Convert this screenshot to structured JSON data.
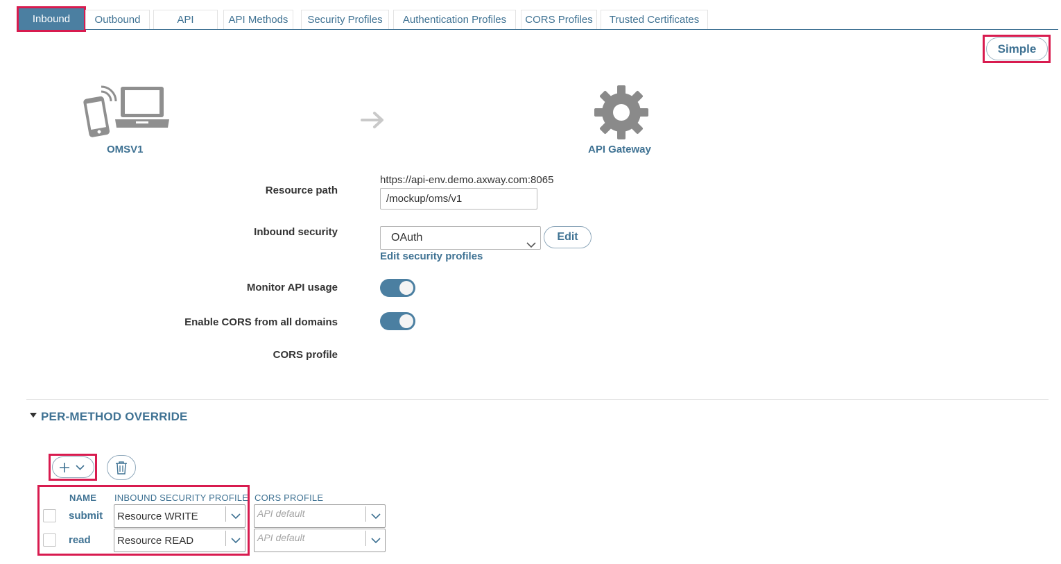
{
  "tabs": [
    {
      "label": "Inbound",
      "active": true
    },
    {
      "label": "Outbound"
    },
    {
      "label": "API"
    },
    {
      "label": "API Methods"
    },
    {
      "label": "Security Profiles"
    },
    {
      "label": "Authentication Profiles"
    },
    {
      "label": "CORS Profiles"
    },
    {
      "label": "Trusted Certificates"
    }
  ],
  "mode_button": "Simple",
  "diagram": {
    "client_label": "OMSV1",
    "gateway_label": "API Gateway",
    "icons": [
      "mobile-laptop-icon",
      "arrow-right-icon",
      "gear-icon"
    ]
  },
  "form": {
    "resource_path_label": "Resource path",
    "base_url": "https://api-env.demo.axway.com:8065",
    "resource_path_value": "/mockup/oms/v1",
    "inbound_security_label": "Inbound security",
    "inbound_security_value": "OAuth",
    "edit_button": "Edit",
    "edit_profiles_link": "Edit security profiles",
    "monitor_label": "Monitor API usage",
    "monitor_on": true,
    "cors_all_label": "Enable CORS from all domains",
    "cors_all_on": true,
    "cors_profile_label": "CORS profile"
  },
  "override": {
    "title": "PER-METHOD OVERRIDE",
    "columns": {
      "name": "NAME",
      "inbound": "INBOUND SECURITY PROFILE",
      "cors": "CORS PROFILE"
    },
    "rows": [
      {
        "name": "submit",
        "inbound": "Resource WRITE",
        "cors_placeholder": "API default"
      },
      {
        "name": "read",
        "inbound": "Resource READ",
        "cors_placeholder": "API default"
      }
    ]
  },
  "colors": {
    "accent": "#3f7293",
    "active_tab": "#4b7fa1",
    "highlight": "#d81b4f"
  }
}
